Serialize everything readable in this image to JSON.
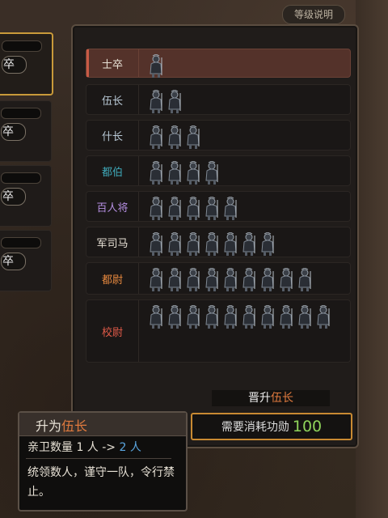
{
  "header": {
    "guide_label": "等级说明"
  },
  "soldier_cards": [
    {
      "rank": "卒",
      "selected": true
    },
    {
      "rank": "卒",
      "selected": false
    },
    {
      "rank": "卒",
      "selected": false
    },
    {
      "rank": "卒",
      "selected": false
    }
  ],
  "ranks": [
    {
      "name": "士卒",
      "color": "#e8e2d6",
      "count": 1,
      "selected": true
    },
    {
      "name": "伍长",
      "color": "#b9c9d6",
      "count": 2,
      "selected": false
    },
    {
      "name": "什长",
      "color": "#b9c9d6",
      "count": 3,
      "selected": false
    },
    {
      "name": "都伯",
      "color": "#3fa8b8",
      "count": 4,
      "selected": false
    },
    {
      "name": "百人将",
      "color": "#b48ee0",
      "count": 5,
      "selected": false
    },
    {
      "name": "军司马",
      "color": "#e8e2d6",
      "count": 7,
      "selected": false
    },
    {
      "name": "都尉",
      "color": "#e6883e",
      "count": 9,
      "selected": false
    },
    {
      "name": "校尉",
      "color": "#e05a48",
      "count": 10,
      "selected": false
    }
  ],
  "promote": {
    "label_prefix": "晋升",
    "target_rank": "伍长",
    "cost_label": "需要消耗功勋",
    "cost_value": "100"
  },
  "tooltip": {
    "title_prefix": "升为",
    "title_rank": "伍长",
    "guard_label": "亲卫数量 1 人 ->",
    "guard_new": "2 人",
    "description": "统领数人，谨守一队，令行禁止。"
  },
  "colors": {
    "accent_orange": "#c98a32",
    "selected_row": "#54322a",
    "highlight_rank": "#e07a3e",
    "highlight_blue": "#5aa6e0",
    "cost_green": "#8fd35a"
  }
}
